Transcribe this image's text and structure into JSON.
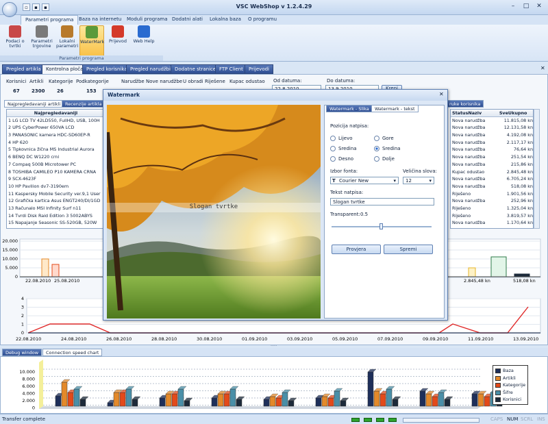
{
  "app": {
    "title": "VSC WebShop  v 1.2.4.29"
  },
  "menu": [
    "Parametri programa",
    "Baza na internetu",
    "Moduli programa",
    "Dodatni alati",
    "Lokalna baza",
    "O programu"
  ],
  "ribbon": {
    "buttons": [
      {
        "label": "Podaci o tvrtki",
        "icon": "building-icon",
        "color": "#c84848"
      },
      {
        "label": "Parametri trgovine",
        "icon": "tools-icon",
        "color": "#7a7a7a"
      },
      {
        "label": "Lokalni parametri",
        "icon": "gear-icon",
        "color": "#b87a2a"
      },
      {
        "label": "WaterMark",
        "icon": "watermark-icon",
        "color": "#5a9a3a"
      },
      {
        "label": "Prijevod",
        "icon": "flag-icon",
        "color": "#d43a2a"
      },
      {
        "label": "Web Help",
        "icon": "help-icon",
        "color": "#2a6bd0"
      }
    ],
    "group": "Parametri programa"
  },
  "tabs": [
    "Pregled artikla",
    "Kontrolna ploča",
    "Pregled korisnika",
    "Pregled narudžbi",
    "Dodatne stranice",
    "FTP Client",
    "Prijevodi"
  ],
  "stats": {
    "headers": [
      "Korisnici",
      "Artikli",
      "Kategorije",
      "Podkategorije"
    ],
    "values": [
      "67",
      "2300",
      "26",
      "153"
    ],
    "order_headers": [
      "Narudžbe",
      "Nove narudžbe",
      "U obradi",
      "Riješene",
      "Kupac odustao"
    ]
  },
  "dates": {
    "from_label": "Od datuma:",
    "from_value": "22.8.2010",
    "to_label": "Do datuma:",
    "to_value": "13.9.2010",
    "button": "Kreni"
  },
  "left_subtabs": [
    "Najpregledavaniji artikli",
    "Recenzije artikla"
  ],
  "top_list": {
    "header": "Najpregledavaniji",
    "items": [
      "1 LG LCD TV 42LD550, FullHD, USB, 100H",
      "2 UPS CyberPower 650VA LCD",
      "3 PANASONIC kamera HDC-SD60EP-R",
      "4 HP 620",
      "5 Tipkovnica žična MS Industrial Aurora",
      "6 BENQ DC W1220 crni",
      "7 Compaq 500B Microtower PC",
      "8 TOSHIBA CAMILEO P10 KAMERA CRNA",
      "9 SCX-4623F",
      "10 HP Pavilion dv7-3190em",
      "11 Kaspersky Mobile Security ver.9,1 User",
      "12 Grafička kartica Asus ENGT240/DI/1GD",
      "13 Računalo MSI Infinity Surf n11",
      "14 Tvrdi Disk Raid Edition 3 5002ABYS",
      "15 Napajanje Seasonic SS-520GB, 520W"
    ]
  },
  "orders": {
    "subtab": "ruke korisnika",
    "headers": [
      "StatusNaziv",
      "SveUkupno"
    ],
    "rows": [
      [
        "Nova narudžba",
        "11.815,08 kn"
      ],
      [
        "Nova narudžba",
        "12.131,58 kn"
      ],
      [
        "Nova narudžba",
        "4.192,08 kn"
      ],
      [
        "Nova narudžba",
        "2.117,17 kn"
      ],
      [
        "Nova narudžba",
        "76,64 kn"
      ],
      [
        "Nova narudžba",
        "251,54 kn"
      ],
      [
        "Nova narudžba",
        "215,86 kn"
      ],
      [
        "Kupac odustao",
        "2.845,48 kn"
      ],
      [
        "Nova narudžba",
        "6.705,24 kn"
      ],
      [
        "Nova narudžba",
        "518,08 kn"
      ],
      [
        "Riješeno",
        "1.901,56 kn"
      ],
      [
        "Nova narudžba",
        "252,96 kn"
      ],
      [
        "Riješeno",
        "1.325,04 kn"
      ],
      [
        "Riješeno",
        "3.819,57 kn"
      ],
      [
        "Nova narudžba",
        "1.170,64 kn"
      ]
    ]
  },
  "chart1": {
    "yticks": [
      "20.000",
      "15.000",
      "10.000",
      "5.000",
      "0"
    ],
    "xlabels": [
      "22.08.2010",
      "25.08.2010"
    ],
    "right_labels": [
      "2.845,48 kn",
      "518,08 kn"
    ]
  },
  "chart2": {
    "yticks": [
      "4",
      "3",
      "2",
      "1",
      "0"
    ],
    "xlabels": [
      "22.08.2010",
      "24.08.2010",
      "26.08.2010",
      "28.08.2010",
      "30.08.2010",
      "01.09.2010",
      "03.09.2010",
      "05.09.2010",
      "07.09.2010",
      "09.09.2010",
      "11.09.2010",
      "13.09.2010"
    ]
  },
  "dialog": {
    "title": "Watermark",
    "tabs": [
      "Watermark - Slika",
      "Watermark - tekst"
    ],
    "watermark_text": "Slogan tvrtke",
    "position_label": "Pozicija natpisa:",
    "positions": [
      "Lijevo",
      "Gore",
      "Sredina",
      "Sredina",
      "Desno",
      "Dolje"
    ],
    "font_label": "Izbor fonta:",
    "font_value": "Courier New",
    "size_label": "Veličina slova:",
    "size_value": "12",
    "text_label": "Tekst natpisa:",
    "text_value": "Slogan tvrtke",
    "transparency_label": "Transparent:",
    "transparency_value": "0.5",
    "check_button": "Provjera",
    "save_button": "Spremi"
  },
  "bottom": {
    "tabs": [
      "Debug window",
      "Connection speed chart"
    ],
    "yticks": [
      "10.000",
      "8.000",
      "6.000",
      "4.000",
      "2.000",
      "0"
    ],
    "legend": [
      {
        "name": "Baza",
        "color": "#1e2f5a"
      },
      {
        "name": "Artikli",
        "color": "#e3892a"
      },
      {
        "name": "Kategorije",
        "color": "#e34a1a"
      },
      {
        "name": "Šifre",
        "color": "#4a8fa8"
      },
      {
        "name": "Korisnici",
        "color": "#1d2a3a"
      }
    ]
  },
  "status": {
    "text": "Transfer complete",
    "caps": "CAPS",
    "num": "NUM",
    "scrl": "SCRL",
    "ins": "INS"
  }
}
